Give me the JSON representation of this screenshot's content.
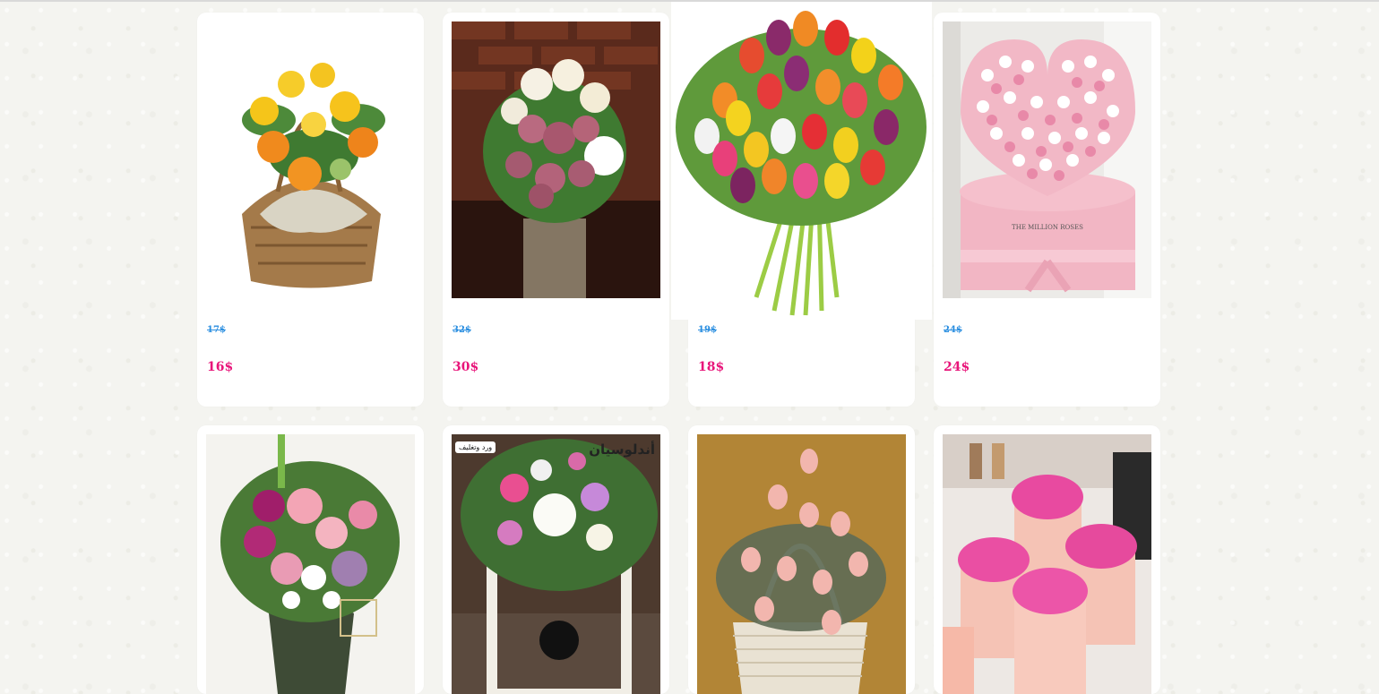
{
  "products": [
    {
      "old_price": "17$",
      "new_price": "16$",
      "image": "flower-basket-orange-yellow-roses"
    },
    {
      "old_price": "32$",
      "new_price": "30$",
      "image": "vase-white-mauve-roses"
    },
    {
      "old_price": "19$",
      "new_price": "18$",
      "image": "tulip-bouquet"
    },
    {
      "old_price": "24$",
      "new_price": "24$",
      "image": "pink-heart-box-roses"
    },
    {
      "image": "pink-purple-bouquet-green-wrap"
    },
    {
      "image": "white-box-flower-arrangement",
      "brand": "أندلوسيان",
      "brand_sub": "ورد وتغليف"
    },
    {
      "image": "pink-roses-wicker-basket"
    },
    {
      "image": "pink-roses-round-boxes"
    }
  ],
  "colors": {
    "old_price": "#2a8ee0",
    "new_price": "#e8157a",
    "card": "#ffffff",
    "background": "#f4f4f0"
  }
}
